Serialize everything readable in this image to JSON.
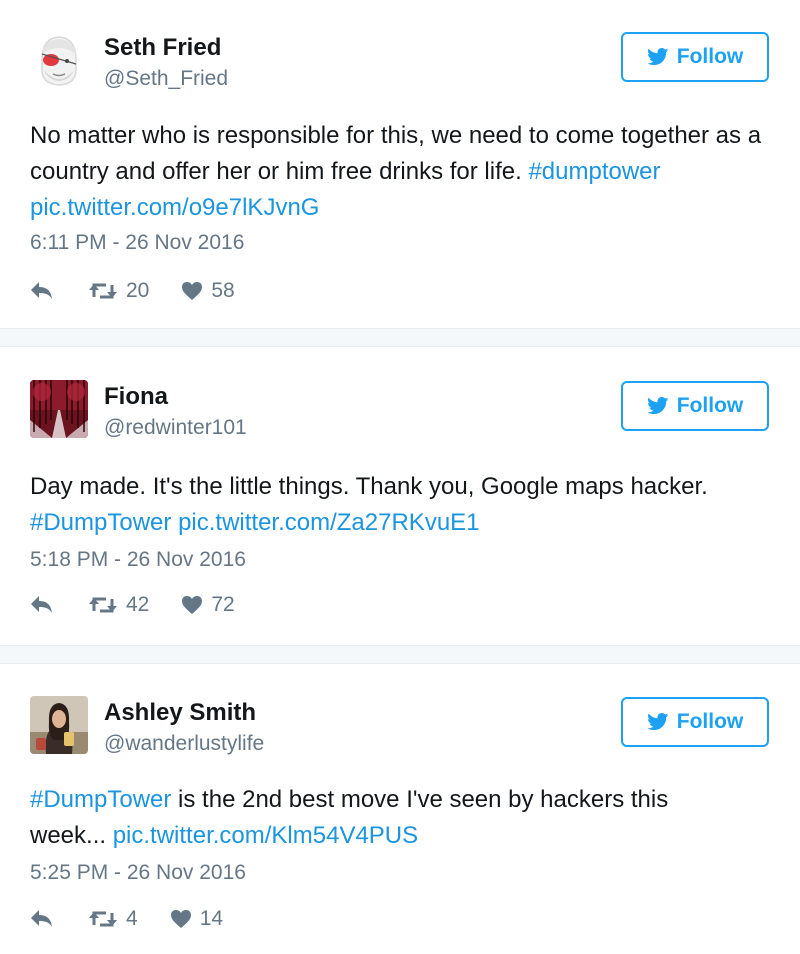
{
  "follow_label": "Follow",
  "colors": {
    "link": "#1b95e0",
    "follow_blue": "#1da1f2",
    "muted": "#657786",
    "text": "#14171a"
  },
  "tweets": [
    {
      "name": "Seth Fried",
      "handle": "@Seth_Fried",
      "text_plain": "No matter who is responsible for this, we need to come together as a country and offer her or him free drinks for life. ",
      "hashtag": "#dumptower",
      "link": "pic.twitter.com/o9e7lKJvnG",
      "timestamp": "6:11 PM - 26 Nov 2016",
      "retweets": "20",
      "likes": "58",
      "avatar_icon": "eyepatch-face-icon"
    },
    {
      "name": "Fiona",
      "handle": "@redwinter101",
      "text_plain": "Day made. It's the little things. Thank you, Google maps hacker. ",
      "hashtag": "#DumpTower",
      "link": "pic.twitter.com/Za27RKvuE1",
      "timestamp": "5:18 PM - 26 Nov 2016",
      "retweets": "42",
      "likes": "72",
      "avatar_icon": "red-forest-photo"
    },
    {
      "name": "Ashley Smith",
      "handle": "@wanderlustylife",
      "hashtag": "#DumpTower",
      "text_plain": " is the 2nd best move I've seen by hackers this week... ",
      "link": "pic.twitter.com/Klm54V4PUS",
      "timestamp": "5:25 PM - 26 Nov 2016",
      "retweets": "4",
      "likes": "14",
      "avatar_icon": "woman-photo"
    }
  ]
}
